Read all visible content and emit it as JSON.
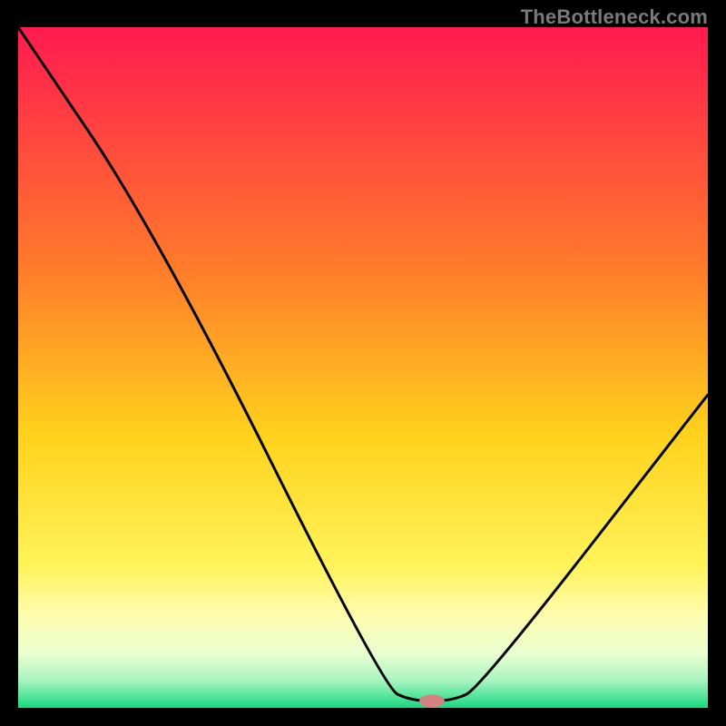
{
  "watermark": "TheBottleneck.com",
  "chart_data": {
    "type": "line",
    "title": "",
    "xlabel": "",
    "ylabel": "",
    "xlim": [
      0,
      100
    ],
    "ylim": [
      0,
      100
    ],
    "grid": false,
    "legend": false,
    "curve": [
      {
        "x": 0,
        "y": 100
      },
      {
        "x": 20,
        "y": 70
      },
      {
        "x": 53,
        "y": 3
      },
      {
        "x": 57,
        "y": 1
      },
      {
        "x": 63,
        "y": 1
      },
      {
        "x": 67,
        "y": 3
      },
      {
        "x": 100,
        "y": 46
      }
    ],
    "marker": {
      "x": 60,
      "y": 1,
      "color": "#d4827f",
      "rx": 14,
      "ry": 7
    },
    "gradient_stops": [
      {
        "pct": 0,
        "color": "#ff1a4f"
      },
      {
        "pct": 35,
        "color": "#ff7a2b"
      },
      {
        "pct": 60,
        "color": "#ffd21c"
      },
      {
        "pct": 79,
        "color": "#fff35a"
      },
      {
        "pct": 86,
        "color": "#fffbaa"
      },
      {
        "pct": 92,
        "color": "#e9ffd0"
      },
      {
        "pct": 96,
        "color": "#a8f4c0"
      },
      {
        "pct": 100,
        "color": "#17d980"
      }
    ]
  }
}
